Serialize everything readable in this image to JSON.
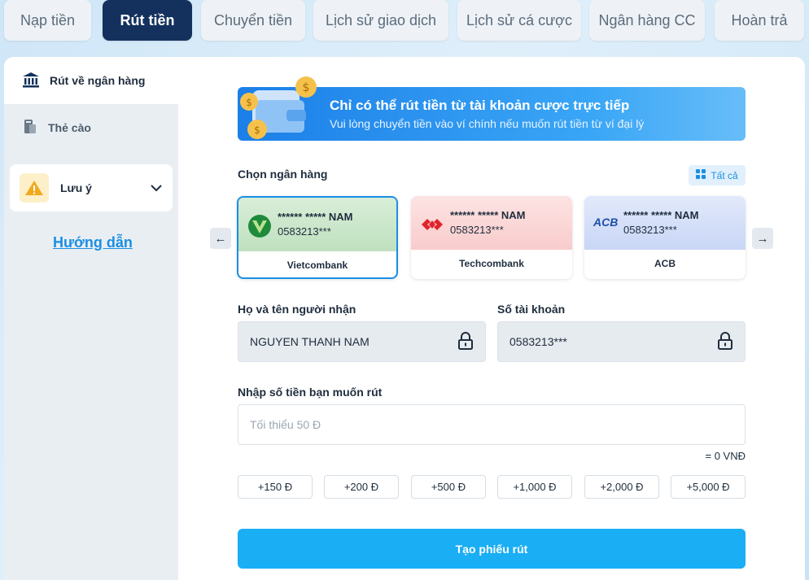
{
  "tabs": [
    {
      "label": "Nạp tiền",
      "active": false
    },
    {
      "label": "Rút tiền",
      "active": true
    },
    {
      "label": "Chuyển tiền",
      "active": false
    },
    {
      "label": "Lịch sử giao dịch",
      "active": false
    },
    {
      "label": "Lịch sử cá cược",
      "active": false
    },
    {
      "label": "Ngân hàng CC",
      "active": false
    },
    {
      "label": "Hoàn trả",
      "active": false
    }
  ],
  "sidebar": {
    "items": [
      {
        "label": "Rút về ngân hàng",
        "icon": "bank-icon",
        "active": true
      },
      {
        "label": "Thẻ cào",
        "icon": "phone-card-icon",
        "active": false
      }
    ],
    "note": {
      "label": "Lưu ý",
      "icon": "warning-icon"
    },
    "guide_link": "Hướng dẫn"
  },
  "banner": {
    "title": "Chỉ có thể rút tiền từ tài khoản cược trực tiếp",
    "subtitle": "Vui lòng chuyển tiền vào ví chính nếu muốn rút tiền từ ví đại lý"
  },
  "bank_section": {
    "label": "Chọn ngân hàng",
    "all_button": "Tất cả",
    "cards": [
      {
        "name": "Vietcombank",
        "masked_holder": "****** ***** NAM",
        "account": "0583213***",
        "selected": true,
        "color_top": "#cfe7cf"
      },
      {
        "name": "Techcombank",
        "masked_holder": "****** ***** NAM",
        "account": "0583213***",
        "selected": false,
        "color_top": "#fbd6d6"
      },
      {
        "name": "ACB",
        "masked_holder": "****** ***** NAM",
        "account": "0583213***",
        "selected": false,
        "color_top": "#d3def8",
        "logo_text": "ACB"
      }
    ]
  },
  "form": {
    "recipient_label": "Họ và tên người nhận",
    "recipient_value": "NGUYEN THANH NAM",
    "account_label": "Số tài khoản",
    "account_value": "0583213***",
    "amount_label": "Nhập số tiền bạn muốn rút",
    "amount_placeholder": "Tối thiểu 50 Đ",
    "converted": "= 0 VNĐ",
    "quick_amounts": [
      "+150 Đ",
      "+200 Đ",
      "+500 Đ",
      "+1,000 Đ",
      "+2,000 Đ",
      "+5,000 Đ"
    ],
    "submit_label": "Tạo phiếu rút"
  },
  "colors": {
    "active_tab": "#13315c",
    "accent": "#1a8fe3",
    "submit": "#1aaef5"
  }
}
